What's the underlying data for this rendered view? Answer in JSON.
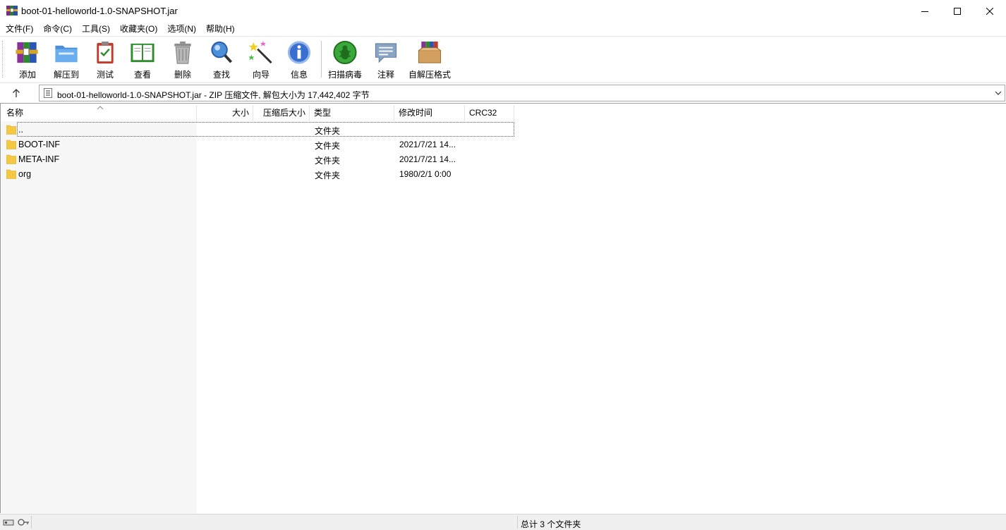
{
  "window": {
    "title": "boot-01-helloworld-1.0-SNAPSHOT.jar"
  },
  "menu": [
    {
      "label": "文件(F)"
    },
    {
      "label": "命令(C)"
    },
    {
      "label": "工具(S)"
    },
    {
      "label": "收藏夹(O)"
    },
    {
      "label": "选项(N)"
    },
    {
      "label": "帮助(H)"
    }
  ],
  "toolbar": {
    "add": "添加",
    "extract": "解压到",
    "test": "测试",
    "view": "查看",
    "delete": "删除",
    "find": "查找",
    "wizard": "向导",
    "info": "信息",
    "scan": "扫描病毒",
    "comment": "注释",
    "sfx": "自解压格式"
  },
  "address": {
    "text": "boot-01-helloworld-1.0-SNAPSHOT.jar - ZIP 压缩文件, 解包大小为 17,442,402 字节"
  },
  "columns": {
    "name": "名称",
    "size": "大小",
    "packed": "压缩后大小",
    "type": "类型",
    "modified": "修改时间",
    "crc": "CRC32"
  },
  "rows": [
    {
      "name": "..",
      "type": "文件夹",
      "modified": ""
    },
    {
      "name": "BOOT-INF",
      "type": "文件夹",
      "modified": "2021/7/21 14..."
    },
    {
      "name": "META-INF",
      "type": "文件夹",
      "modified": "2021/7/21 14..."
    },
    {
      "name": "org",
      "type": "文件夹",
      "modified": "1980/2/1 0:00"
    }
  ],
  "status": {
    "summary": "总计 3 个文件夹"
  },
  "colors": {
    "folder": "#f5c842",
    "window_bg": "#ffffff",
    "name_column_bg": "#f7f7f7",
    "statusbar_bg": "#f0f0f0"
  }
}
